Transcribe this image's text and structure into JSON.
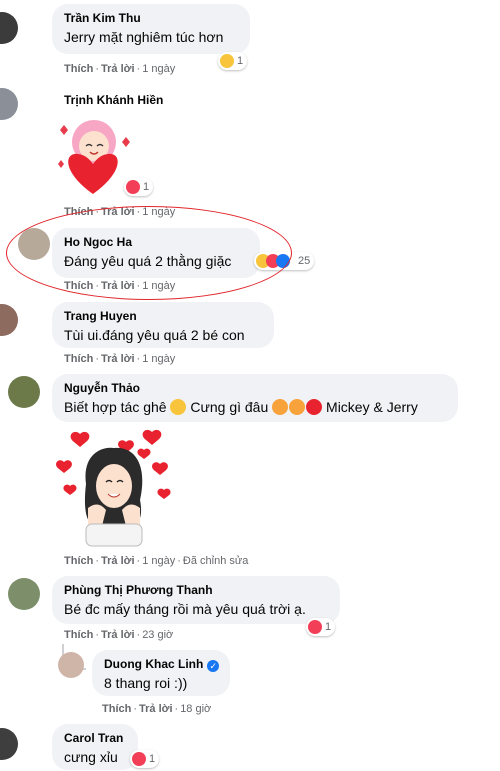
{
  "meta_labels": {
    "like": "Thích",
    "reply": "Trả lời",
    "dot": "·"
  },
  "comments": [
    {
      "author": "Trần Kim Thu",
      "text": "Jerry mặt nghiêm túc hơn",
      "time": "1 ngày",
      "reaction_count": "1",
      "reaction": "haha-icon"
    },
    {
      "author": "Trịnh Khánh Hiền",
      "time": "1 ngày",
      "reaction_count": "1",
      "reaction": "heart-icon",
      "sticker": "heart-hug-sticker"
    },
    {
      "author": "Ho Ngoc Ha",
      "text": "Đáng yêu quá 2 thằng giặc",
      "time": "1 ngày",
      "reaction_count": "25",
      "reaction": "haha-love-like-icons"
    },
    {
      "author": "Trang Huyen",
      "text": "Tùi ui.đáng yêu quá 2 bé con",
      "time": "1 ngày"
    },
    {
      "author": "Nguyễn Thảo",
      "text_parts": [
        "Biết hợp tác ghê ",
        " Cưng gì đâu ",
        " Mickey & Jerry"
      ],
      "time": "1 ngày",
      "edited": "Đã chỉnh sửa",
      "sticker": "avatar-hearts-sticker"
    },
    {
      "author": "Phùng Thị Phương Thanh",
      "text": "Bé đc mấy tháng rồi mà yêu quá trời ạ.",
      "time": "23 giờ",
      "reaction_count": "1",
      "reaction": "heart-icon"
    },
    {
      "author": "Duong Khac Linh",
      "text": "8 thang roi :))",
      "time": "18 giờ",
      "verified": "verified-badge-icon"
    },
    {
      "author": "Carol Tran",
      "text": "cưng xỉu",
      "reaction_count": "1",
      "reaction": "heart-icon"
    }
  ],
  "colors": {
    "bubble": "#f0f2f5",
    "meta": "#65676b",
    "highlight": "#e0262b",
    "love": "#f33e58",
    "like": "#1877f2",
    "haha": "#f7c43b"
  }
}
